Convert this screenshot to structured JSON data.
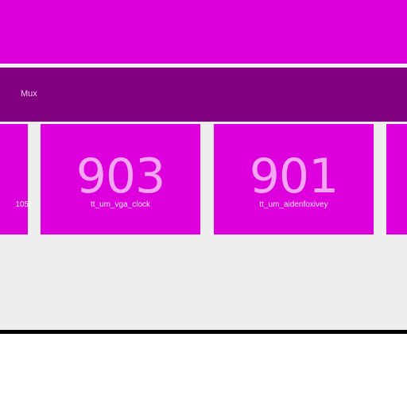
{
  "header": {
    "section_label": "Mux"
  },
  "tiles": [
    {
      "number": "",
      "name": "105"
    },
    {
      "number": "903",
      "name": "tt_um_vga_clock"
    },
    {
      "number": "901",
      "name": "tt_um_aidenfoxivey"
    },
    {
      "number": "",
      "name": ""
    }
  ],
  "colors": {
    "tile_bg": "#dd00dd",
    "section_bar_bg": "#800080",
    "grid_bg": "#eeeeee",
    "bottom_rule": "#000000"
  }
}
